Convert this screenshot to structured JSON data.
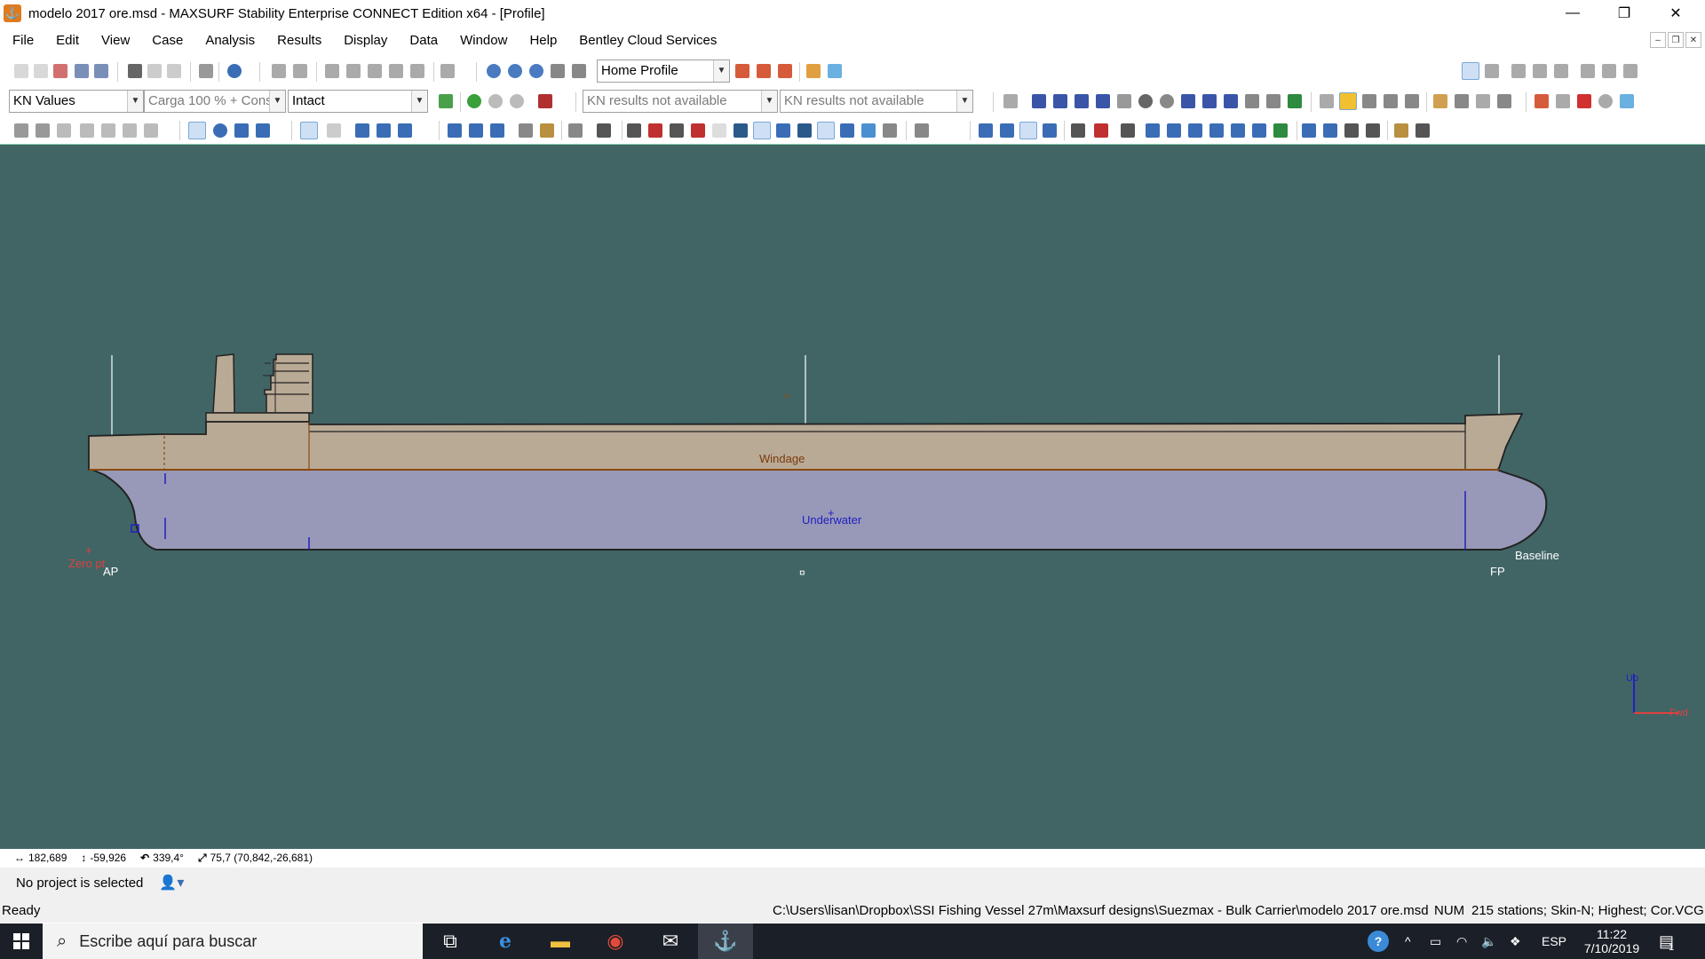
{
  "window": {
    "title": "modelo 2017 ore.msd - MAXSURF Stability Enterprise CONNECT Edition x64 - [Profile]",
    "minimize": "—",
    "restore": "❐",
    "close": "✕"
  },
  "menu": [
    "File",
    "Edit",
    "View",
    "Case",
    "Analysis",
    "Results",
    "Display",
    "Data",
    "Window",
    "Help",
    "Bentley Cloud Services"
  ],
  "toolbar1": {
    "view_combo": "Home Profile"
  },
  "toolbar2": {
    "analysis_combo": "KN Values",
    "loadcase_combo": "Carga 100 % + Cons",
    "damage_combo": "Intact",
    "results_combo_1": "KN results not available",
    "results_combo_2": "KN results not available"
  },
  "canvas": {
    "background": "#416565",
    "labels": {
      "windage": "Windage",
      "underwater": "Underwater",
      "zero_pt": "Zero pt",
      "ap": "AP",
      "fp": "FP",
      "baseline": "Baseline",
      "midship": "¤",
      "axis_up": "Up",
      "axis_fwd": "Fwd"
    },
    "colors": {
      "hull_above": "#b9aa96",
      "hull_below": "#9899b8",
      "waterline": "#8a4a10",
      "station_line": "#ffffff"
    }
  },
  "coords": {
    "x": "182,689",
    "y": "-59,926",
    "angle": "339,4°",
    "dist": "75,7 (70,842,-26,681)"
  },
  "project": {
    "status": "No project is selected"
  },
  "status": {
    "ready": "Ready",
    "path": "C:\\Users\\lisan\\Dropbox\\SSI Fishing Vessel 27m\\Maxsurf designs\\Suezmax - Bulk Carrier\\modelo 2017 ore.msd",
    "num": "NUM",
    "info": "215 stations; Skin-N; Highest; Cor.VCG"
  },
  "taskbar": {
    "search_placeholder": "Escribe aquí para buscar",
    "lang": "ESP",
    "time": "11:22",
    "date": "7/10/2019",
    "notif_count": "1"
  }
}
